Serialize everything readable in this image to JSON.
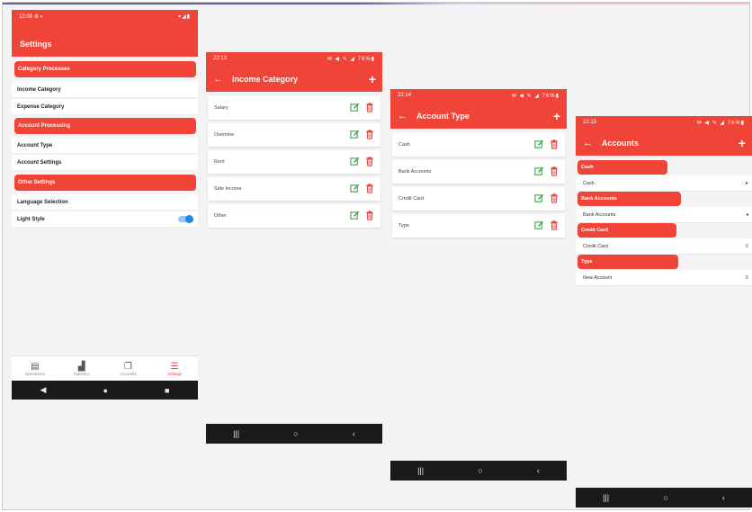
{
  "colors": {
    "accent": "#f04438",
    "toggle": "#1e88e5",
    "edit": "#3ea34a",
    "delete": "#e53935"
  },
  "settings": {
    "status_time": "12:08",
    "status_right": "▾◢▮",
    "title": "Settings",
    "sections": [
      {
        "header": "Category Processes",
        "rows": [
          "Income Category",
          "Expense Category"
        ]
      },
      {
        "header": "Account Processing",
        "rows": [
          "Account Type",
          "Account Settings"
        ]
      },
      {
        "header": "Other Settings",
        "rows": [
          "Language Selection",
          "Light Style"
        ]
      }
    ],
    "light_style_on": true,
    "bottom_nav": [
      {
        "label": "Operations",
        "icon": "book-icon"
      },
      {
        "label": "Statistics",
        "icon": "bar-chart-icon"
      },
      {
        "label": "Accounts",
        "icon": "cards-icon"
      },
      {
        "label": "Settings",
        "icon": "settings-list-icon"
      }
    ],
    "sysnav": [
      "◀",
      "●",
      "■"
    ]
  },
  "income": {
    "status_time": "22:13",
    "status_right": "✉ ◀ ✎ ◢ 76%▮",
    "title": "Income Category",
    "items": [
      "Salary",
      "Overtime",
      "Rent",
      "Side Income",
      "Other"
    ],
    "sysnav": [
      "|||",
      "○",
      "‹"
    ]
  },
  "account_type": {
    "status_time": "22:14",
    "status_right": "✉ ◀ ✎ ◢ 76%▮",
    "title": "Account Type",
    "items": [
      "Cash",
      "Bank Accounts",
      "Credit Card",
      "Type"
    ],
    "sysnav": [
      "|||",
      "○",
      "‹"
    ]
  },
  "accounts": {
    "status_time": "22:15",
    "status_right": "✉ ◀ ✎ ◢ 76%▮",
    "title": "Accounts",
    "groups": [
      {
        "header": "Cash",
        "rows": [
          {
            "label": "Cash",
            "icon": "▸"
          }
        ]
      },
      {
        "header": "Bank Accounts",
        "rows": [
          {
            "label": "Bank Accounts",
            "icon": "◂"
          }
        ]
      },
      {
        "header": "Credit Card",
        "rows": [
          {
            "label": "Credit Card",
            "icon": "≡"
          }
        ]
      },
      {
        "header": "Type",
        "rows": [
          {
            "label": "New Account",
            "icon": "≡"
          }
        ]
      }
    ],
    "sysnav": [
      "|||",
      "○",
      "‹"
    ]
  }
}
